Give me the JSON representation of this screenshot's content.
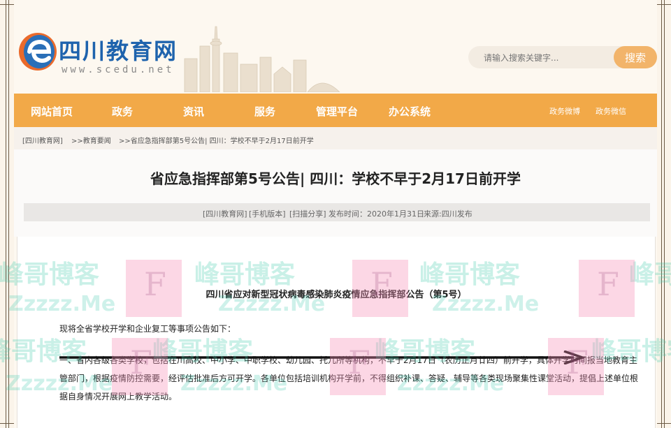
{
  "site": {
    "name": "四川教育网",
    "url": "www.scedu.net"
  },
  "search": {
    "placeholder": "请输入搜索关键字...",
    "button": "搜索"
  },
  "nav": {
    "items": [
      "网站首页",
      "政务",
      "资讯",
      "服务",
      "管理平台",
      "办公系统"
    ],
    "right": [
      "政务微博",
      "政务微信"
    ]
  },
  "breadcrumb": [
    "[四川教育网]",
    ">>教育要闻",
    ">>省应急指挥部第5号公告| 四川：学校不早于2月17日前开学"
  ],
  "article": {
    "title": "省应急指挥部第5号公告| 四川：学校不早于2月17日前开学",
    "meta": {
      "site": "[四川教育网]",
      "mobile": "[手机版本]",
      "share": "[扫描分享]",
      "published": "发布时间：2020年1月31日",
      "source": "来源:四川发布"
    },
    "notice_title": "四川省应对新型冠状病毒感染肺炎疫情应急指挥部公告（第5号）",
    "intro": "现将全省学校开学和企业复工等事项公告如下：",
    "paragraph": "一、省内各级各类学校，包括在川高校、中小学、中职学校、幼儿园、托儿所等机构，不早于2月17日（农历正月廿四）前开学，具体开学时间报当地教育主管部门，根据疫情防控需要，经评估批准后方可开学。各单位包括培训机构开学前，不得组织补课、答疑、辅导等各类现场聚集性课堂活动，提倡上述单位根据自身情况开展网上教学活动。"
  },
  "watermark": {
    "text": "峰哥博客",
    "domain": "Zzzzz.Me",
    "letter": "F"
  },
  "colors": {
    "nav_bg": "#f2a948",
    "search_btn": "#f2b46a",
    "logo_blue": "#1e63ad"
  }
}
